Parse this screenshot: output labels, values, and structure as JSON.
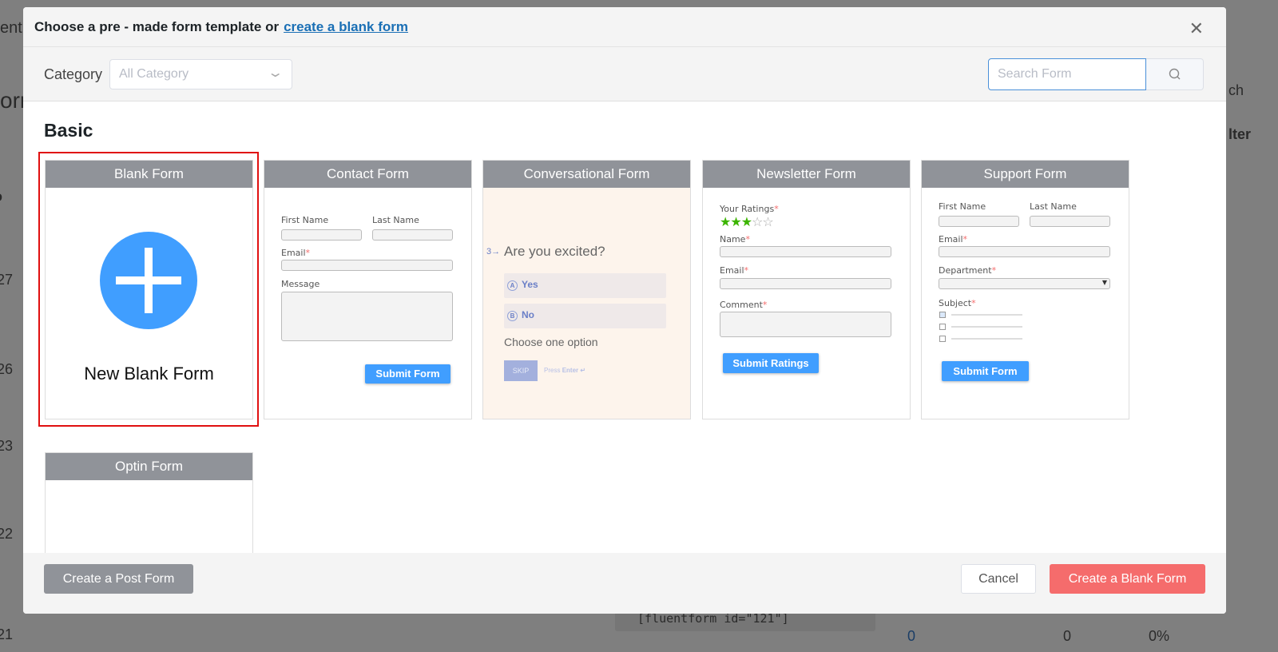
{
  "background": {
    "title_frag": "ent",
    "heading_frag": "orm",
    "col_frag": "o",
    "rows": [
      "27",
      "26",
      "23",
      "22",
      "21"
    ],
    "search_frag": "ch",
    "filter_frag": "lter",
    "shortcode": "[fluentform id=\"121\"]",
    "stat1": "0",
    "stat2": "0",
    "stat3": "0%"
  },
  "modal": {
    "title": "Choose a pre - made form template or",
    "title_link": "create a blank form",
    "close_icon": "close-icon"
  },
  "toolbar": {
    "category_label": "Category",
    "category_placeholder": "All Category",
    "search_placeholder": "Search Form"
  },
  "section": "Basic",
  "cards": [
    {
      "title": "Blank Form",
      "label": "New Blank Form"
    },
    {
      "title": "Contact Form",
      "fields": [
        "First Name",
        "Last Name",
        "Email",
        "Message"
      ],
      "button": "Submit Form"
    },
    {
      "title": "Conversational Form",
      "step": "3→",
      "question": "Are you excited?",
      "options": [
        {
          "key": "A",
          "label": "Yes"
        },
        {
          "key": "B",
          "label": "No"
        }
      ],
      "hint": "Choose one option",
      "skip": "SKIP",
      "press": "Press",
      "enter": "Enter ↵"
    },
    {
      "title": "Newsletter Form",
      "fields": [
        "Your Ratings",
        "Name",
        "Email",
        "Comment"
      ],
      "rating": 3,
      "rating_max": 5,
      "button": "Submit Ratings"
    },
    {
      "title": "Support Form",
      "fields": [
        "First Name",
        "Last Name",
        "Email",
        "Department",
        "Subject"
      ],
      "button": "Submit Form"
    },
    {
      "title": "Optin Form"
    }
  ],
  "footer": {
    "post_form": "Create a Post Form",
    "cancel": "Cancel",
    "create": "Create a Blank Form"
  },
  "colors": {
    "accent": "#409eff",
    "danger": "#f56c6c",
    "card_header": "#909399",
    "selected": "#e01010"
  }
}
